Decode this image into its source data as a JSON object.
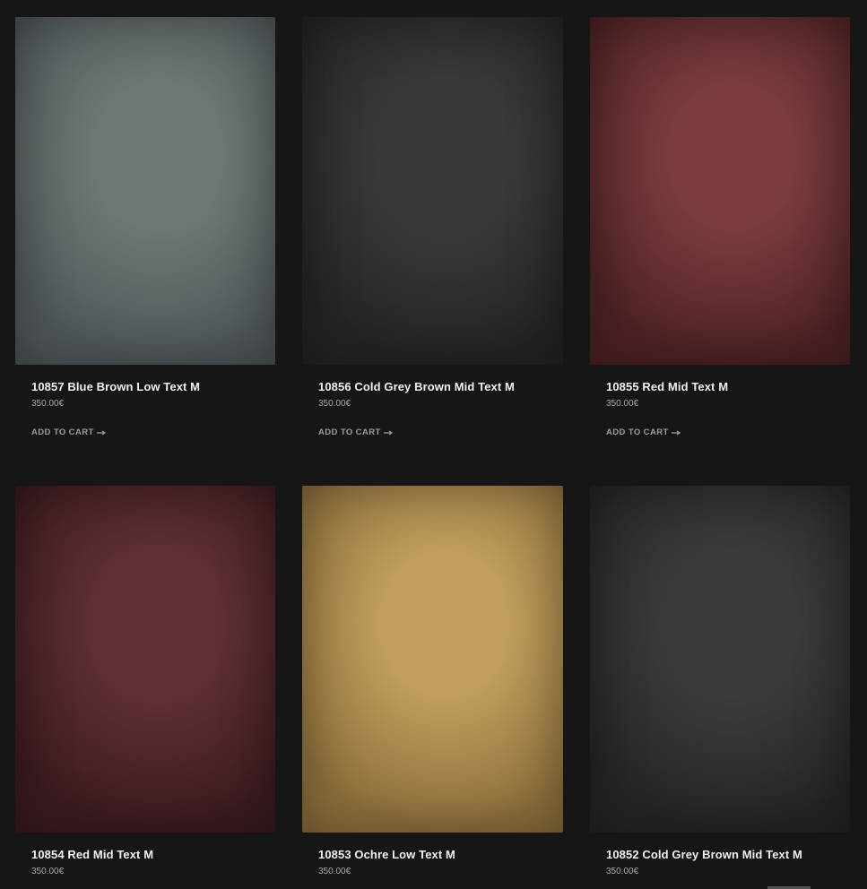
{
  "products": [
    {
      "title": "10857 Blue Brown Low Text M",
      "price": "350.00€",
      "action": "ADD TO CART",
      "color": "#6e7778",
      "color_edge": "#4f5659"
    },
    {
      "title": "10856 Cold Grey Brown Mid Text M",
      "price": "350.00€",
      "action": "ADD TO CART",
      "color": "#3a3838",
      "color_edge": "#252424"
    },
    {
      "title": "10855 Red Mid Text M",
      "price": "350.00€",
      "action": "ADD TO CART",
      "color": "#7a3c3e",
      "color_edge": "#4e2224"
    },
    {
      "title": "10854 Red Mid Text M",
      "price": "350.00€",
      "action": "",
      "color": "#5f2f33",
      "color_edge": "#3b1b1f"
    },
    {
      "title": "10853 Ochre Low Text M",
      "price": "350.00€",
      "action": "",
      "color": "#c19e5c",
      "color_edge": "#8c6f3b"
    },
    {
      "title": "10852 Cold Grey Brown Mid Text M",
      "price": "350.00€",
      "action": "",
      "color": "#3d3b39",
      "color_edge": "#262524"
    }
  ]
}
